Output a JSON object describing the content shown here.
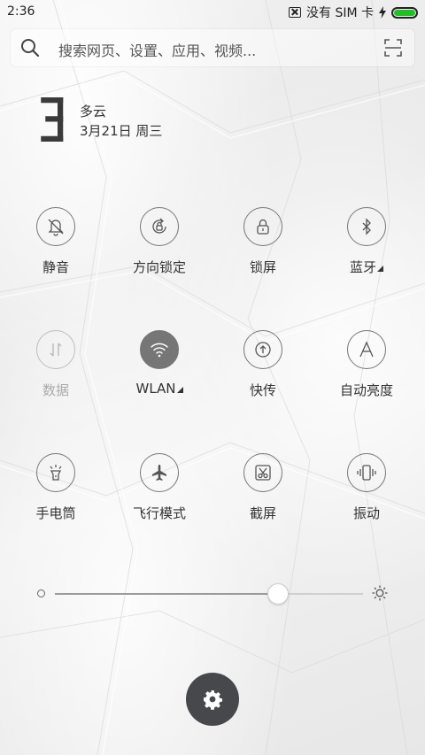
{
  "status_bar": {
    "time": "2:36",
    "sim_text": "没有 SIM 卡",
    "battery_level": 1.0,
    "battery_color": "#1fc01f"
  },
  "search": {
    "placeholder": "搜索网页、设置、应用、视频...",
    "left_icon": "search-icon",
    "right_icon": "scan-icon"
  },
  "weather": {
    "temperature": "3",
    "degree": "°",
    "condition": "多云",
    "date": "3月21日 周三"
  },
  "toggles": [
    {
      "label": "静音",
      "icon": "bell-mute-icon",
      "state": "off"
    },
    {
      "label": "方向锁定",
      "icon": "rotation-lock-icon",
      "state": "off"
    },
    {
      "label": "锁屏",
      "icon": "lock-icon",
      "state": "off"
    },
    {
      "label": "蓝牙",
      "icon": "bluetooth-icon",
      "state": "off",
      "has_menu": true
    },
    {
      "label": "数据",
      "icon": "mobile-data-icon",
      "state": "disabled"
    },
    {
      "label": "WLAN",
      "icon": "wifi-icon",
      "state": "on",
      "has_menu": true
    },
    {
      "label": "快传",
      "icon": "quick-share-icon",
      "state": "off"
    },
    {
      "label": "自动亮度",
      "icon": "auto-brightness-icon",
      "state": "off"
    },
    {
      "label": "手电筒",
      "icon": "flashlight-icon",
      "state": "off"
    },
    {
      "label": "飞行模式",
      "icon": "airplane-icon",
      "state": "off"
    },
    {
      "label": "截屏",
      "icon": "screenshot-icon",
      "state": "off"
    },
    {
      "label": "振动",
      "icon": "vibrate-icon",
      "state": "off"
    }
  ],
  "brightness": {
    "level": 0.72
  },
  "settings_button": {
    "icon": "gear-icon",
    "color": "#47484c"
  },
  "colors": {
    "toggle_on": "#767676",
    "text": "#333333",
    "text_dim": "#aaaaaa"
  }
}
